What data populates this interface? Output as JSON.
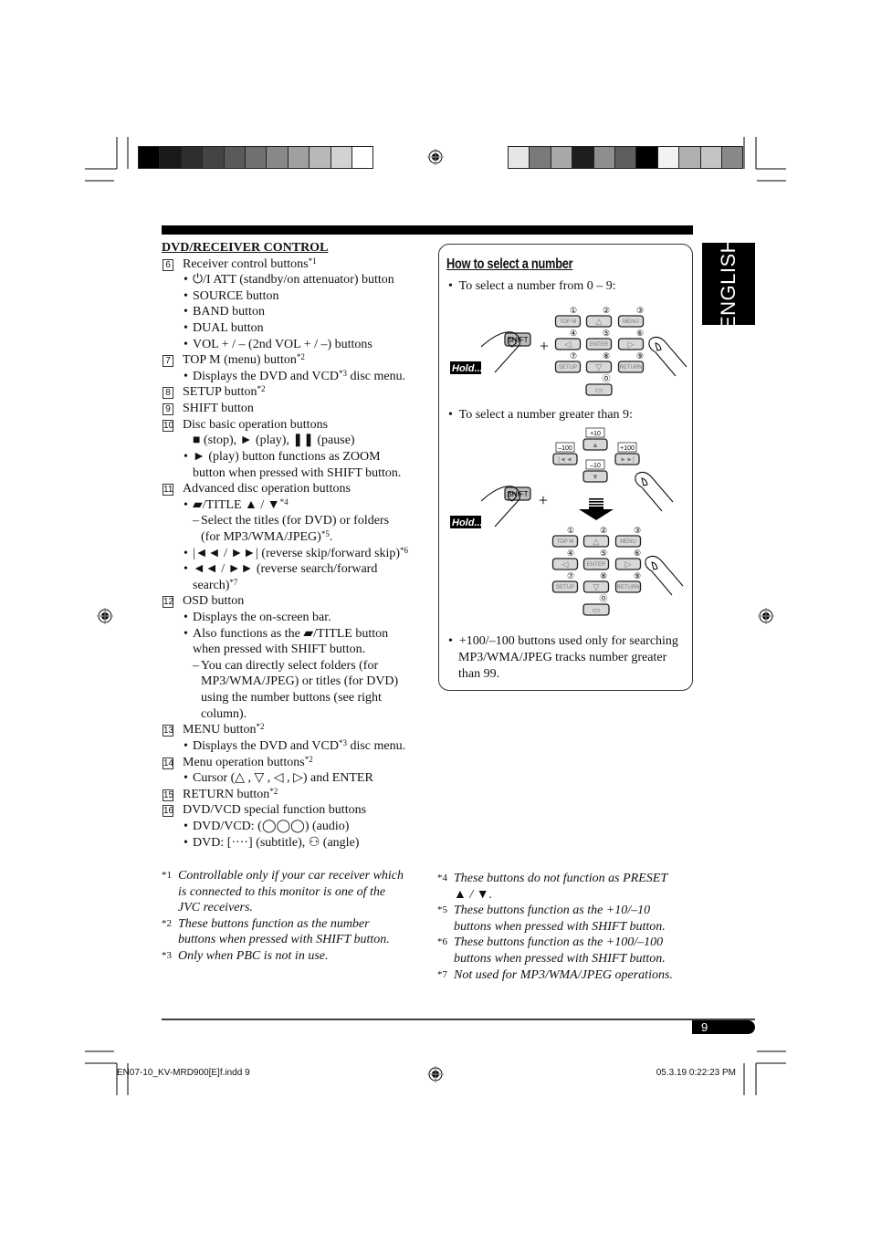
{
  "colors": {
    "bars_left": [
      "#000000",
      "#1a1a1a",
      "#2e2e2e",
      "#444444",
      "#5a5a5a",
      "#717171",
      "#888888",
      "#a0a0a0",
      "#b8b8b8",
      "#d2d2d2",
      "#ffffff"
    ],
    "bars_right": [
      "#e6e6e6",
      "#7a7a7a",
      "#a8a8a8",
      "#1e1e1e",
      "#8e8e8e",
      "#5e5e5e",
      "#000000",
      "#f2f2f2",
      "#b0b0b0",
      "#c4c4c4",
      "#888888"
    ]
  },
  "tab_label": "ENGLISH",
  "left": {
    "heading": "DVD/RECEIVER CONTROL",
    "lines": [
      {
        "k": "num",
        "n": "6",
        "t": "Receiver control buttons",
        "s": "*1"
      },
      {
        "k": "b",
        "t": "⏻/I ATT (standby/on attenuator) button"
      },
      {
        "k": "b",
        "t": "SOURCE button"
      },
      {
        "k": "b",
        "t": "BAND button"
      },
      {
        "k": "b",
        "t": "DUAL button"
      },
      {
        "k": "b",
        "t": "VOL + / – (2nd VOL + / –) buttons"
      },
      {
        "k": "num",
        "n": "7",
        "t": "TOP M (menu) button",
        "s": "*2"
      },
      {
        "k": "b",
        "t": "Displays the DVD and VCD",
        "s": "*3",
        "a": " disc menu."
      },
      {
        "k": "num",
        "n": "8",
        "t": "SETUP button",
        "s": "*2"
      },
      {
        "k": "num",
        "n": "9",
        "t": "SHIFT button"
      },
      {
        "k": "num",
        "n": "10",
        "t": "Disc basic operation buttons"
      },
      {
        "k": "c",
        "t": "■ (stop), ► (play), ❚❚ (pause)"
      },
      {
        "k": "b",
        "t": "► (play) button functions as ZOOM"
      },
      {
        "k": "c",
        "t": "button when pressed with SHIFT button."
      },
      {
        "k": "num",
        "n": "11",
        "t": "Advanced disc operation buttons"
      },
      {
        "k": "b",
        "t": "▰/TITLE ▲ / ▼",
        "s": "*4"
      },
      {
        "k": "d",
        "t": "Select the titles (for DVD) or folders"
      },
      {
        "k": "dc",
        "t": "(for MP3/WMA/JPEG)",
        "s": "*5",
        "a": "."
      },
      {
        "k": "b",
        "t": "|◄◄ / ►►| (reverse skip/forward skip)",
        "s": "*6"
      },
      {
        "k": "b",
        "t": "◄◄ / ►► (reverse search/forward"
      },
      {
        "k": "c",
        "t": "search)",
        "s": "*7"
      },
      {
        "k": "num",
        "n": "12",
        "t": "OSD button"
      },
      {
        "k": "b",
        "t": "Displays the on-screen bar."
      },
      {
        "k": "b",
        "t": "Also functions as the ▰/TITLE button"
      },
      {
        "k": "c",
        "t": "when pressed with SHIFT button."
      },
      {
        "k": "d",
        "t": "You can directly select folders (for"
      },
      {
        "k": "dc",
        "t": "MP3/WMA/JPEG) or titles (for DVD)"
      },
      {
        "k": "dc",
        "t": "using the number buttons (see right"
      },
      {
        "k": "dc",
        "t": "column)."
      },
      {
        "k": "num",
        "n": "13",
        "t": "MENU button",
        "s": "*2"
      },
      {
        "k": "b",
        "t": "Displays the DVD and VCD",
        "s": "*3",
        "a": " disc menu."
      },
      {
        "k": "num",
        "n": "14",
        "t": "Menu operation buttons",
        "s": "*2"
      },
      {
        "k": "b",
        "t": "Cursor (△ , ▽ , ◁ , ▷) and ENTER"
      },
      {
        "k": "num",
        "n": "15",
        "t": "RETURN button",
        "s": "*2"
      },
      {
        "k": "num",
        "n": "16",
        "t": "DVD/VCD special function buttons"
      },
      {
        "k": "b",
        "t": "DVD/VCD: (◯◯◯) (audio)"
      },
      {
        "k": "b",
        "t": "DVD: [····] (subtitle), ⚇ (angle)"
      }
    ],
    "footnotes": [
      {
        "m": "*1",
        "l": [
          "Controllable only if your car receiver which",
          "is connected to this monitor is one of the",
          "JVC receivers."
        ]
      },
      {
        "m": "*2",
        "l": [
          "These buttons function as the number",
          "buttons when pressed with SHIFT button."
        ]
      },
      {
        "m": "*3",
        "l": [
          "Only when PBC is not in use."
        ]
      }
    ]
  },
  "box": {
    "title": "How to select a number",
    "bullet1": "To select a number from 0 – 9:",
    "bullet2": "To select a number greater than 9:",
    "bullet3": [
      "+100/–100 buttons used only for searching",
      "MP3/WMA/JPEG tracks number greater",
      "than 99."
    ],
    "shift_label": "SHIFT",
    "hold_label": "Hold....",
    "keypad": {
      "numbers": [
        "①",
        "②",
        "③",
        "④",
        "⑤",
        "⑥",
        "⑦",
        "⑧",
        "⑨",
        "⓪"
      ],
      "labels": [
        "TOP M",
        "△",
        "MENU",
        "◁",
        "ENTER",
        "▷",
        "SETUP",
        "▽",
        "RETURN",
        "▭"
      ]
    },
    "skip": {
      "plus10": "+10",
      "minus10": "–10",
      "minus100": "–100",
      "plus100": "+100",
      "up": "▲",
      "down": "▼",
      "prev": "|◄◄",
      "next": "►►|"
    }
  },
  "right_footnotes": [
    {
      "m": "*4",
      "l": [
        "These buttons do not function as PRESET",
        "▲ / ▼."
      ]
    },
    {
      "m": "*5",
      "l": [
        "These buttons function as the +10/–10",
        "buttons when pressed with SHIFT button."
      ]
    },
    {
      "m": "*6",
      "l": [
        "These buttons function as the +100/–100",
        "buttons when pressed with SHIFT button."
      ]
    },
    {
      "m": "*7",
      "l": [
        "Not used for MP3/WMA/JPEG operations."
      ]
    }
  ],
  "page_number": "9",
  "slug": {
    "file": "EN07-10_KV-MRD900[E]f.indd   9",
    "date": "05.3.19   0:22:23 PM"
  }
}
